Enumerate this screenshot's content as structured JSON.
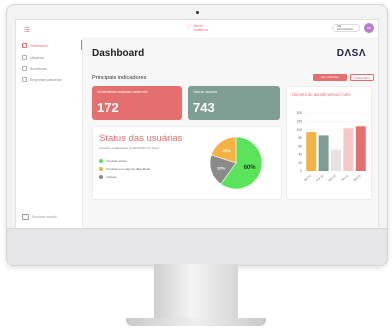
{
  "sidebar": {
    "items": [
      {
        "label": "Dashboard",
        "active": true
      },
      {
        "label": "Usuários",
        "active": false
      },
      {
        "label": "Benefícios",
        "active": false
      },
      {
        "label": "Empresas parceiras",
        "active": false
      }
    ],
    "logout_label": "Encerrar sessão"
  },
  "topbar": {
    "brand_line1": "Bebê",
    "brand_line2": "Materno",
    "user_greeting": "Olá",
    "user_name": "Administrador",
    "avatar_initials": "AD"
  },
  "page": {
    "title": "Dashboard",
    "logo_text": "DΛSΛ",
    "section_title": "Principais indicadores",
    "primary_button": "Ver relatórios",
    "secondary_button": "Aplicar filtro"
  },
  "cards": {
    "attendances": {
      "label": "Atendimentos realizados neste mês",
      "value": "172",
      "color": "#e56f6f"
    },
    "users": {
      "label": "Total de usuários",
      "value": "743",
      "color": "#7f9d92"
    }
  },
  "status": {
    "title": "Status das usuárias",
    "subtitle": "Usuários cadastradas no BebêMaterno Dasa",
    "legend": [
      {
        "label": "Usuárias ativas",
        "color": "#5be35b"
      },
      {
        "label": "Usuárias com alguma dificuldade",
        "color": "#f4b342"
      },
      {
        "label": "Inativas",
        "color": "#8a8a8a"
      }
    ]
  },
  "chart_data": [
    {
      "type": "pie",
      "title": "Status das usuárias",
      "slices": [
        {
          "label": "Usuárias ativas",
          "value": 60,
          "display": "60%",
          "color": "#5be35b"
        },
        {
          "label": "Inativas",
          "value": 20,
          "display": "20%",
          "color": "#8a8a8a"
        },
        {
          "label": "Usuárias com alguma dificuldade",
          "value": 20,
          "display": "20%",
          "color": "#f4b342"
        }
      ]
    },
    {
      "type": "bar",
      "title": "Número de atendimentos / mês",
      "categories": [
        "Jan 22",
        "Fev 22",
        "Mar 22",
        "Abr 22",
        "Mai 22"
      ],
      "values": [
        94,
        86,
        52,
        108,
        120
      ],
      "colors": [
        "#f4b342",
        "#7f9d92",
        "#e9e2de",
        "#f4c8c4",
        "#e56f6f"
      ],
      "ylim": [
        0,
        200
      ],
      "yticks": [
        0,
        20,
        40,
        60,
        80,
        100,
        150,
        200
      ],
      "grid": true
    }
  ]
}
